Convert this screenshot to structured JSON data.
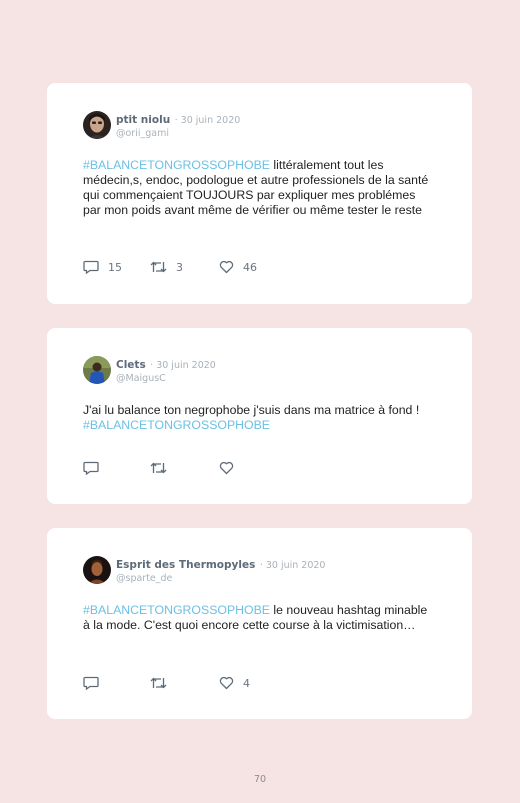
{
  "tweets": [
    {
      "name": "ptit niolu",
      "date": "· 30 juin 2020",
      "handle": "@orii_gami",
      "hashtag": "#BALANCETONGROSSOPHOBE",
      "text": " littéralement tout les médecin,s, endoc, podologue et autre professionels de la santé qui commençaient TOUJOURS par expliquer mes problémes par mon poids avant même de vérifier ou même tester le reste",
      "replies": "15",
      "retweets": "3",
      "likes": "46"
    },
    {
      "name": "Clets",
      "date": "· 30 juin 2020",
      "handle": "@MaigusC",
      "text_before": "J'ai lu balance ton negrophobe j'suis dans ma matrice à fond ! ",
      "hashtag": "#BALANCETONGROSSOPHOBE"
    },
    {
      "name": "Esprit des Thermopyles",
      "date": "· 30 juin 2020",
      "handle": "@sparte_de",
      "hashtag": "#BALANCETONGROSSOPHOBE",
      "text": " le nouveau hashtag minable à la mode. C'est quoi encore cette course à la victimisation…",
      "likes": "4"
    }
  ],
  "page_number": "70",
  "colors": {
    "background": "#f6e3e3",
    "hashtag": "#6cc0e4",
    "icon": "#5d6a78"
  }
}
